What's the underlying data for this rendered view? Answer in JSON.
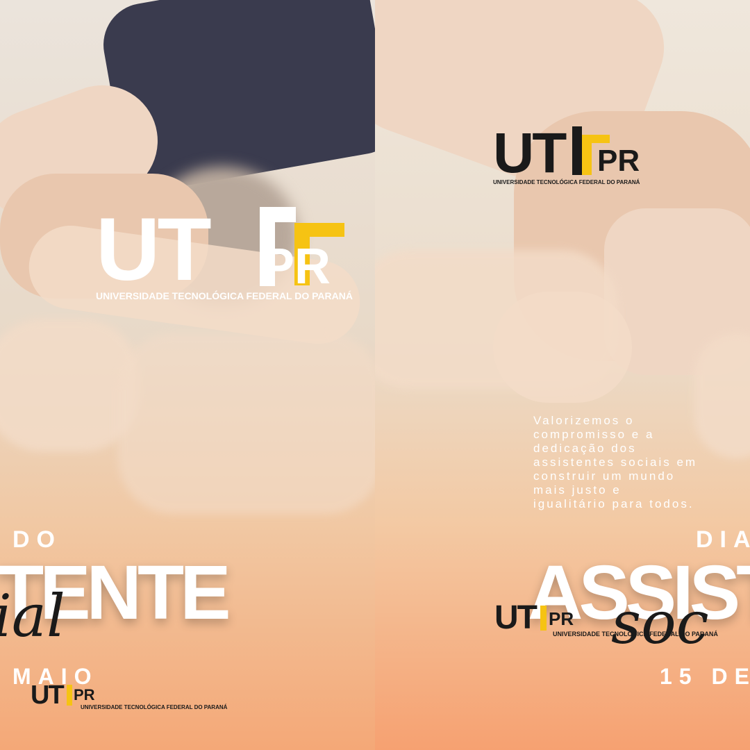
{
  "logo": {
    "ut": "UT",
    "pr": "PR",
    "subtitle_left": "UNIVERSIDADE TECNOLÓGICA FEDERAL DO PARANÁ",
    "subtitle_right": "UNIVERSIDADE TECNOLÓGICA FEDERAL DO PARANÁ"
  },
  "left": {
    "line_top": "DO",
    "line_big": "TENTE",
    "line_script": "ial",
    "line_date": "MAIO"
  },
  "right": {
    "message": "Valorizemos o compromisso e a dedicação dos assistentes sociais em construir um mundo mais justo e igualitário para todos.",
    "line_top": "DIA",
    "line_big": "ASSIST",
    "line_script": "soc",
    "line_date": "15 DE"
  },
  "colors": {
    "accent_yellow": "#f6c313",
    "dark_text": "#1a1a1a",
    "sleeve": "#3a3b4e",
    "orange": "#f4a877"
  }
}
